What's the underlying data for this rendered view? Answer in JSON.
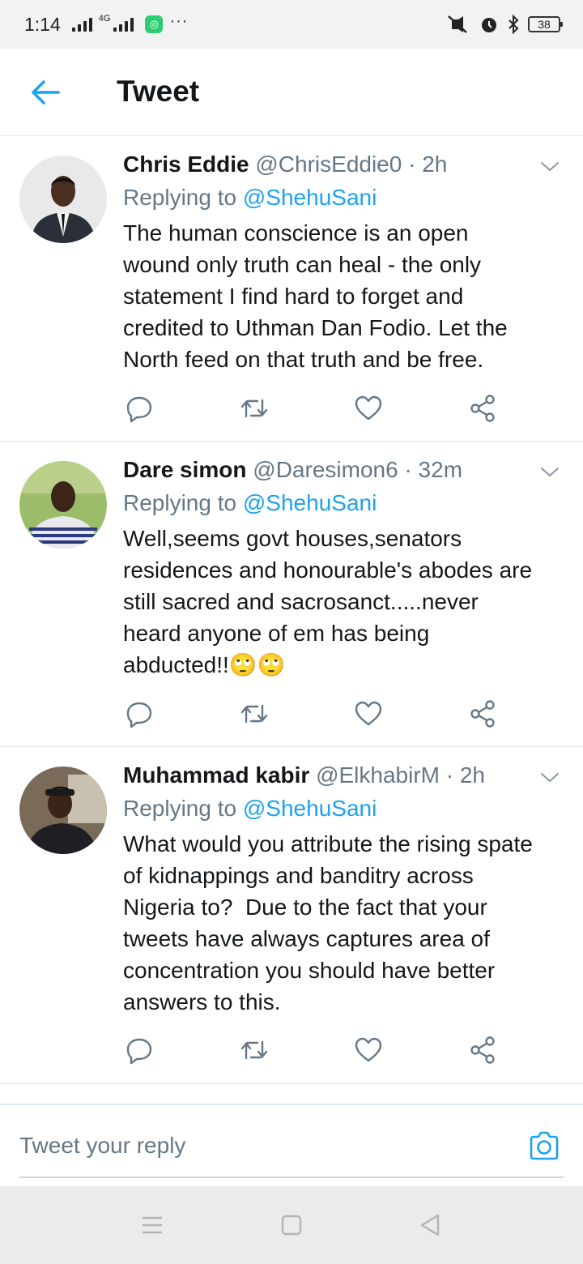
{
  "status_bar": {
    "time": "1:14",
    "network": "4G",
    "more": "···",
    "battery": "38",
    "icons": [
      "signal-icon",
      "4g-signal-icon",
      "app-notification-icon",
      "mute-icon",
      "alarm-icon",
      "bluetooth-icon",
      "battery-icon"
    ]
  },
  "header": {
    "title": "Tweet",
    "back_icon": "back-arrow-icon"
  },
  "tweets": [
    {
      "name": "Chris Eddie",
      "handle": "@ChrisEddie0",
      "sep": " · ",
      "time": "2h",
      "replying_prefix": "Replying to ",
      "replying_to": "@ShehuSani",
      "text": "The human conscience is an open\nwound only truth can heal - the only\nstatement I find hard to forget and\ncredited to Uthman Dan Fodio. Let the\nNorth feed on that truth and be free."
    },
    {
      "name": "Dare simon",
      "handle": "@Daresimon6",
      "sep": " · ",
      "time": "32m",
      "replying_prefix": "Replying to ",
      "replying_to": "@ShehuSani",
      "text": "Well,seems govt houses,senators\nresidences and honourable's abodes are\nstill sacred and sacrosanct.....never\nheard anyone of em has being\nabducted!!🙄🙄"
    },
    {
      "name": "Muhammad kabir",
      "handle": "@ElkhabirM",
      "sep": " · ",
      "time": "2h",
      "replying_prefix": "Replying to ",
      "replying_to": "@ShehuSani",
      "text": "What would you attribute the rising spate\nof kidnappings and banditry across\nNigeria to?  Due to the fact that your\ntweets have always captures area of\nconcentration you should have better\nanswers to this."
    }
  ],
  "actions": [
    "reply-icon",
    "retweet-icon",
    "like-icon",
    "share-icon"
  ],
  "reply_bar": {
    "placeholder": "Tweet your reply",
    "camera_icon": "camera-icon"
  },
  "nav": [
    "menu-icon",
    "home-square-icon",
    "back-triangle-icon"
  ],
  "colors": {
    "accent": "#1da1f2",
    "secondary_text": "#657786",
    "divider": "#e1e8ed"
  }
}
